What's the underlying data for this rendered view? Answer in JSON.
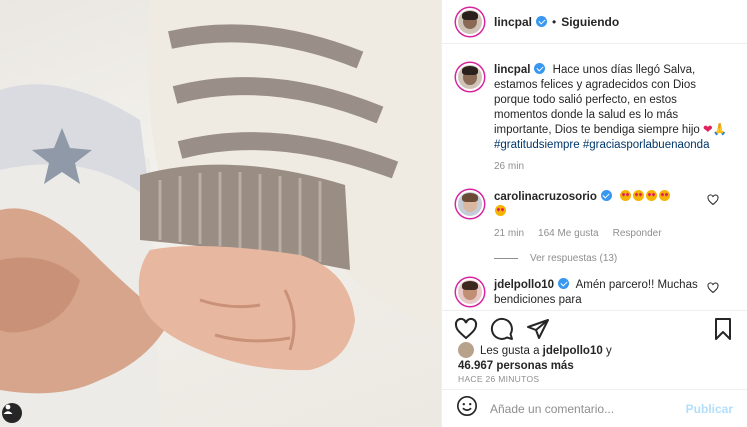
{
  "post": {
    "author": "lincpal",
    "follow_status": "Siguiendo",
    "dot": "•",
    "caption": "Hace unos días llegó Salva, estamos felices y agradecidos con Dios porque todo salió perfecto, en estos momentos donde la salud es lo más importante, Dios te bendiga siempre hijo",
    "hashtag1": "#gratitudsiempre",
    "hashtag2": "#graciasporlabuenaonda",
    "caption_time": "26 min"
  },
  "comments": [
    {
      "user": "carolinacruzosorio",
      "time": "21 min",
      "likes": "164 Me gusta",
      "reply": "Responder",
      "view_replies": "Ver respuestas (13)"
    },
    {
      "user": "jdelpollo10",
      "text": "Amén parcero!! Muchas bendiciones para"
    }
  ],
  "likes": {
    "prefix": "Les gusta a",
    "user": "jdelpollo10",
    "connector": "y",
    "count": "46.967 personas más"
  },
  "timestamp": "HACE 26 MINUTOS",
  "add_comment": {
    "placeholder": "Añade un comentario...",
    "publish": "Publicar"
  },
  "icons": {
    "like": "heart-icon",
    "comment": "comment-icon",
    "share": "paper-plane-icon",
    "save": "bookmark-icon",
    "emoji": "smiley-icon",
    "verified": "verified-badge-icon"
  },
  "colors": {
    "verified": "#3897f0",
    "hashtag": "#00376b",
    "muted": "#8e8e8e",
    "publish_disabled": "#b2dffc",
    "story_ring": "#d6249f"
  }
}
